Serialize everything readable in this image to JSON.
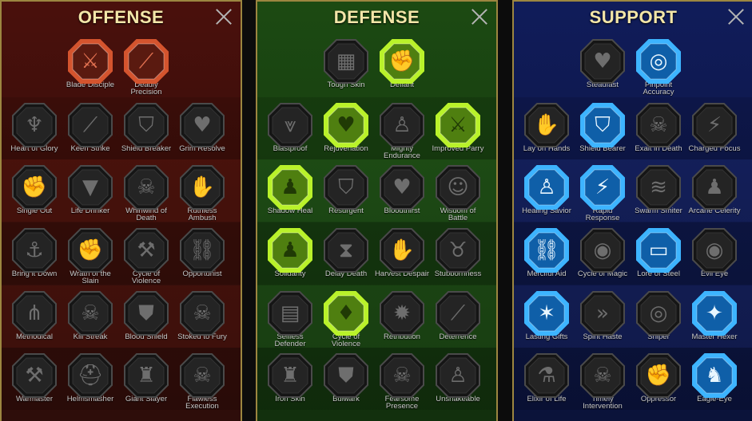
{
  "panels": [
    {
      "id": "offense",
      "title": "OFFENSE",
      "skills": [
        {
          "label": "Blade Disciple",
          "active": true,
          "icon": "crossed-swords-icon",
          "glyph": "⚔"
        },
        {
          "label": "Deadly Precision",
          "active": true,
          "icon": "claw-slash-icon",
          "glyph": "⟋"
        },
        {
          "label": "Heart of Glory",
          "active": false,
          "icon": "heroic-figure-icon",
          "glyph": "♆"
        },
        {
          "label": "Keen Strike",
          "active": false,
          "icon": "blade-strike-icon",
          "glyph": "⟋"
        },
        {
          "label": "Shield Breaker",
          "active": false,
          "icon": "broken-shield-icon",
          "glyph": "⛉"
        },
        {
          "label": "Grim Resolve",
          "active": false,
          "icon": "spiked-heart-icon",
          "glyph": "♥"
        },
        {
          "label": "Single Out",
          "active": false,
          "icon": "targeting-fist-icon",
          "glyph": "✊"
        },
        {
          "label": "Life Drinker",
          "active": false,
          "icon": "fangs-icon",
          "glyph": "▼"
        },
        {
          "label": "Whirlwind of Death",
          "active": false,
          "icon": "skull-swirl-icon",
          "glyph": "☠"
        },
        {
          "label": "Ruthless Ambush",
          "active": false,
          "icon": "grabbing-hand-icon",
          "glyph": "✋"
        },
        {
          "label": "Bring it Down",
          "active": false,
          "icon": "drop-sword-icon",
          "glyph": "⚓"
        },
        {
          "label": "Wrath of the Slain",
          "active": false,
          "icon": "fist-sword-icon",
          "glyph": "✊"
        },
        {
          "label": "Cycle of Violence",
          "active": false,
          "icon": "axes-icon",
          "glyph": "⚒"
        },
        {
          "label": "Opportunist",
          "active": false,
          "icon": "chain-links-icon",
          "glyph": "⛓"
        },
        {
          "label": "Methodical",
          "active": false,
          "icon": "claws-icon",
          "glyph": "⋔"
        },
        {
          "label": "Kill Streak",
          "active": false,
          "icon": "skull-icon",
          "glyph": "☠"
        },
        {
          "label": "Blood Shield",
          "active": false,
          "icon": "bloody-shield-icon",
          "glyph": "⛊"
        },
        {
          "label": "Stoked to Fury",
          "active": false,
          "icon": "flaming-skull-icon",
          "glyph": "☠"
        },
        {
          "label": "Warmaster",
          "active": false,
          "icon": "warhammer-icon",
          "glyph": "⚒"
        },
        {
          "label": "Helmsmasher",
          "active": false,
          "icon": "helmet-icon",
          "glyph": "⛑"
        },
        {
          "label": "Giant Slayer",
          "active": false,
          "icon": "giant-figure-icon",
          "glyph": "♜"
        },
        {
          "label": "Flawless Execution",
          "active": false,
          "icon": "crowned-skull-icon",
          "glyph": "☠"
        }
      ]
    },
    {
      "id": "defense",
      "title": "DEFENSE",
      "skills": [
        {
          "label": "Tough Skin",
          "active": false,
          "icon": "scales-armor-icon",
          "glyph": "▦"
        },
        {
          "label": "Defiant",
          "active": true,
          "icon": "raised-fist-icon",
          "glyph": "✊"
        },
        {
          "label": "Blastproof",
          "active": false,
          "icon": "chevron-armor-icon",
          "glyph": "⩔"
        },
        {
          "label": "Rejuvenation",
          "active": true,
          "icon": "healing-heart-icon",
          "glyph": "♥"
        },
        {
          "label": "Mighty Endurance",
          "active": false,
          "icon": "muscle-torso-icon",
          "glyph": "♙"
        },
        {
          "label": "Improved Parry",
          "active": true,
          "icon": "parry-blades-icon",
          "glyph": "⚔"
        },
        {
          "label": "Shadow Heal",
          "active": true,
          "icon": "shadow-figure-icon",
          "glyph": "♟"
        },
        {
          "label": "Resurgent",
          "active": false,
          "icon": "knight-shield-icon",
          "glyph": "⛉"
        },
        {
          "label": "Bloodthirst",
          "active": false,
          "icon": "skull-heart-icon",
          "glyph": "♥"
        },
        {
          "label": "Wisdom of Battle",
          "active": false,
          "icon": "meditating-head-icon",
          "glyph": "☺"
        },
        {
          "label": "Solidarity",
          "active": true,
          "icon": "group-figures-icon",
          "glyph": "♟"
        },
        {
          "label": "Delay Death",
          "active": false,
          "icon": "hourglass-icon",
          "glyph": "⧗"
        },
        {
          "label": "Harvest Despair",
          "active": false,
          "icon": "eye-hand-icon",
          "glyph": "✋"
        },
        {
          "label": "Stubbornness",
          "active": false,
          "icon": "bull-head-icon",
          "glyph": "♉"
        },
        {
          "label": "Selfless Defender",
          "active": false,
          "icon": "wall-defender-icon",
          "glyph": "▤"
        },
        {
          "label": "Cycle of Violence",
          "active": true,
          "icon": "blood-drops-icon",
          "glyph": "♦"
        },
        {
          "label": "Retribution",
          "active": false,
          "icon": "burst-skull-icon",
          "glyph": "✹"
        },
        {
          "label": "Deterrence",
          "active": false,
          "icon": "twin-blades-icon",
          "glyph": "⟋"
        },
        {
          "label": "Iron Skin",
          "active": false,
          "icon": "armored-warrior-icon",
          "glyph": "♜"
        },
        {
          "label": "Bulwark",
          "active": false,
          "icon": "tower-shield-icon",
          "glyph": "⛊"
        },
        {
          "label": "Fearsome Presence",
          "active": false,
          "icon": "horned-skull-icon",
          "glyph": "☠"
        },
        {
          "label": "Unshakeable",
          "active": false,
          "icon": "flexing-warrior-icon",
          "glyph": "♙"
        }
      ]
    },
    {
      "id": "support",
      "title": "SUPPORT",
      "skills": [
        {
          "label": "Steadfast",
          "active": false,
          "icon": "heart-sparkle-icon",
          "glyph": "♥"
        },
        {
          "label": "Pinpoint Accuracy",
          "active": true,
          "icon": "targeting-hand-icon",
          "glyph": "◎"
        },
        {
          "label": "Lay on Hands",
          "active": false,
          "icon": "praying-hands-icon",
          "glyph": "✋"
        },
        {
          "label": "Shield Bearer",
          "active": true,
          "icon": "radiant-shield-icon",
          "glyph": "⛉"
        },
        {
          "label": "Exalt in Death",
          "active": false,
          "icon": "skull-icon",
          "glyph": "☠"
        },
        {
          "label": "Charged Focus",
          "active": false,
          "icon": "charged-arm-icon",
          "glyph": "⚡"
        },
        {
          "label": "Healing Savior",
          "active": true,
          "icon": "healing-figure-icon",
          "glyph": "♙"
        },
        {
          "label": "Rapid Response",
          "active": true,
          "icon": "lightning-icon",
          "glyph": "⚡"
        },
        {
          "label": "Swarm Smiter",
          "active": false,
          "icon": "vortex-icon",
          "glyph": "≋"
        },
        {
          "label": "Arcane Celerity",
          "active": false,
          "icon": "running-figure-icon",
          "glyph": "♟"
        },
        {
          "label": "Merciful Aid",
          "active": true,
          "icon": "chained-figure-icon",
          "glyph": "⛓"
        },
        {
          "label": "Cycle of Magic",
          "active": false,
          "icon": "magic-orb-icon",
          "glyph": "◉"
        },
        {
          "label": "Lore of Steel",
          "active": true,
          "icon": "open-book-icon",
          "glyph": "▭"
        },
        {
          "label": "Evil Eye",
          "active": false,
          "icon": "evil-eye-icon",
          "glyph": "◉"
        },
        {
          "label": "Lasting Gifts",
          "active": true,
          "icon": "star-burst-icon",
          "glyph": "✶"
        },
        {
          "label": "Spirit Haste",
          "active": false,
          "icon": "winged-boot-icon",
          "glyph": "»"
        },
        {
          "label": "Sniper",
          "active": false,
          "icon": "sniper-eye-icon",
          "glyph": "◎"
        },
        {
          "label": "Master Hexer",
          "active": true,
          "icon": "hex-figure-icon",
          "glyph": "✦"
        },
        {
          "label": "Elixir of Life",
          "active": false,
          "icon": "potion-flask-icon",
          "glyph": "⚗"
        },
        {
          "label": "Timely Intervention",
          "active": false,
          "icon": "winged-skull-icon",
          "glyph": "☠"
        },
        {
          "label": "Oppressor",
          "active": false,
          "icon": "crushing-fist-icon",
          "glyph": "✊"
        },
        {
          "label": "Eagle-Eye",
          "active": true,
          "icon": "eagle-head-icon",
          "glyph": "♞"
        }
      ]
    }
  ],
  "colors": {
    "offense_active_glow": "#d4542e",
    "defense_active_glow": "#b9f22a",
    "support_active_glow": "#3db4ff",
    "inactive_fill": "#242424",
    "inactive_border": "#4a4a4a",
    "title_color": "#f3e6a8",
    "panel_border": "#9c8640"
  }
}
